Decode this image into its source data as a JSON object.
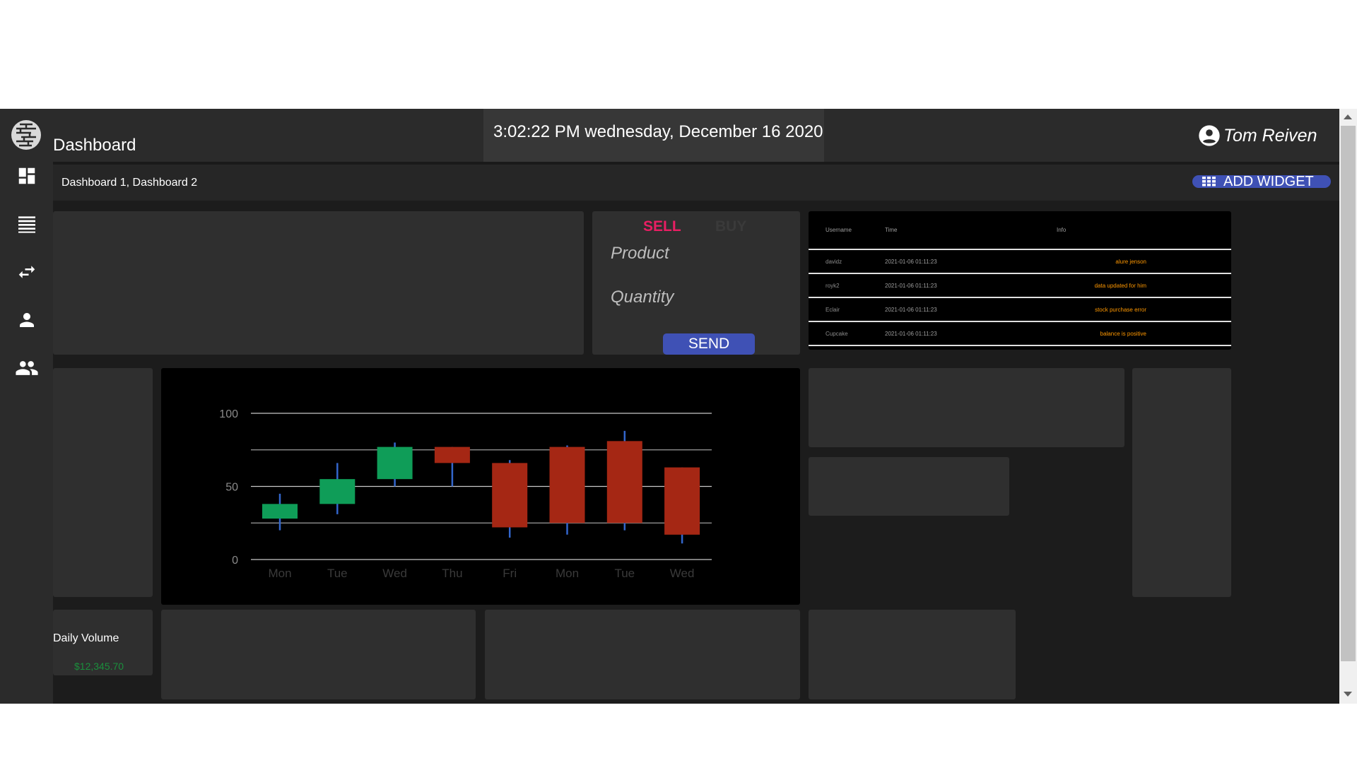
{
  "app": {
    "title": "Dashboard",
    "datetime": "3:02:22 PM wednesday, December 16 2020",
    "user_name": "Tom Reiven"
  },
  "sidebar": {
    "items": [
      {
        "icon": "dashboard-icon"
      },
      {
        "icon": "list-icon"
      },
      {
        "icon": "swap-icon"
      },
      {
        "icon": "person-icon"
      },
      {
        "icon": "people-icon"
      }
    ]
  },
  "breadcrumb": "Dashboard 1, Dashboard 2",
  "add_widget_label": "ADD WIDGET",
  "trade": {
    "sell_label": "SELL",
    "buy_label": "BUY",
    "product_label": "Product",
    "quantity_label": "Quantity",
    "send_label": "SEND"
  },
  "activity_table": {
    "headers": [
      "Username",
      "Time",
      "Info"
    ],
    "rows": [
      {
        "user": "davidz",
        "time": "2021-01-06 01:11:23",
        "info": "alure jenson"
      },
      {
        "user": "royk2",
        "time": "2021-01-06 01:11:23",
        "info": "data updated for him"
      },
      {
        "user": "Eclair",
        "time": "2021-01-06 01:11:23",
        "info": "stock purchase error"
      },
      {
        "user": "Cupcake",
        "time": "2021-01-06 01:11:23",
        "info": "balance is positive"
      }
    ]
  },
  "daily_volume": {
    "label": "Daily Volume",
    "value": "$12,345.70"
  },
  "colors": {
    "up": "#0f9d58",
    "down": "#a52714",
    "wick": "#3366cc",
    "accent": "#3f51b5",
    "sell": "#e91e63",
    "info": "#ff9800"
  },
  "chart_data": {
    "type": "candlestick",
    "categories": [
      "Mon",
      "Tue",
      "Wed",
      "Thu",
      "Fri",
      "Mon",
      "Tue",
      "Wed"
    ],
    "candles": [
      {
        "low": 20,
        "open": 28,
        "close": 38,
        "high": 45
      },
      {
        "low": 31,
        "open": 38,
        "close": 55,
        "high": 66
      },
      {
        "low": 50,
        "open": 55,
        "close": 77,
        "high": 80
      },
      {
        "low": 50,
        "open": 77,
        "close": 66,
        "high": 77
      },
      {
        "low": 15,
        "open": 66,
        "close": 22,
        "high": 68
      },
      {
        "low": 17,
        "open": 77,
        "close": 25,
        "high": 78
      },
      {
        "low": 20,
        "open": 81,
        "close": 25,
        "high": 88
      },
      {
        "low": 11,
        "open": 63,
        "close": 17,
        "high": 63
      }
    ],
    "yticks": [
      0,
      50,
      100
    ],
    "ylim": [
      0,
      100
    ],
    "grid": true
  }
}
